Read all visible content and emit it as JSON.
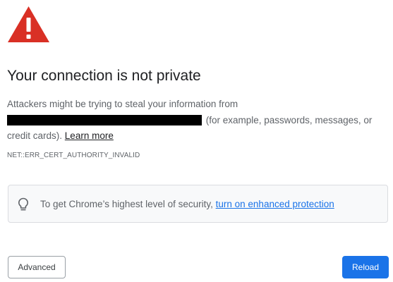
{
  "interstitial": {
    "title": "Your connection is not private",
    "body_prefix": "Attackers might be trying to steal your information from",
    "body_suffix": "(for example, passwords, messages, or credit cards).",
    "learn_more_label": "Learn more",
    "error_code": "NET::ERR_CERT_AUTHORITY_INVALID",
    "icon": "warning-triangle-icon",
    "icon_color": "#d93025"
  },
  "security_notice": {
    "icon": "lightbulb-icon",
    "text": "To get Chrome’s highest level of security,",
    "link_label": "turn on enhanced protection",
    "link_color": "#1a73e8"
  },
  "actions": {
    "advanced_label": "Advanced",
    "reload_label": "Reload",
    "reload_color": "#1a73e8"
  }
}
